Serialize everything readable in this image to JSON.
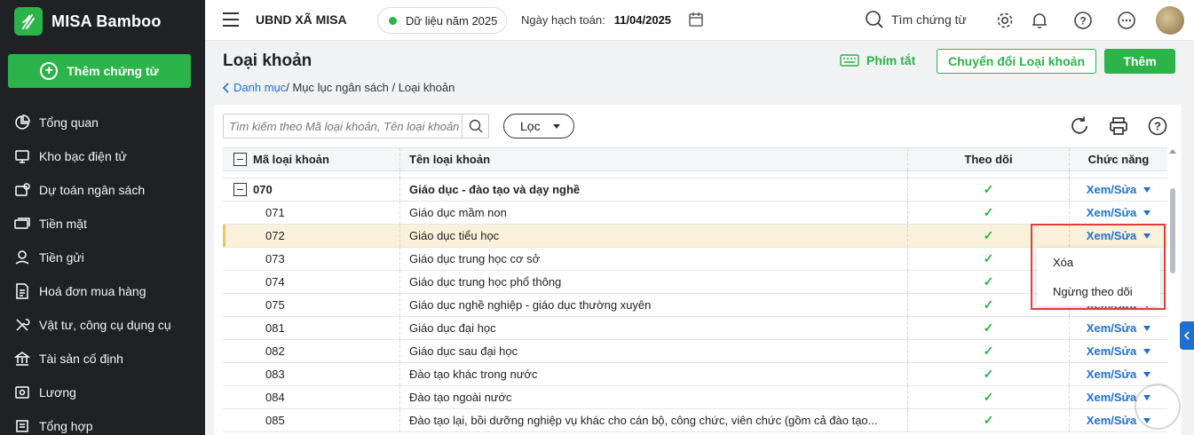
{
  "brand": {
    "name": "MISA Bamboo",
    "add_voucher": "Thêm chứng từ"
  },
  "sidebar": {
    "items": [
      {
        "label": "Tổng quan",
        "icon": "pie-chart-icon"
      },
      {
        "label": "Kho bạc điện tử",
        "icon": "monitor-icon"
      },
      {
        "label": "Dự toán ngân sách",
        "icon": "budget-icon"
      },
      {
        "label": "Tiền mặt",
        "icon": "cash-icon"
      },
      {
        "label": "Tiền gửi",
        "icon": "deposit-icon"
      },
      {
        "label": "Hoá đơn mua hàng",
        "icon": "invoice-icon"
      },
      {
        "label": "Vật tư, công cụ dụng cụ",
        "icon": "tools-icon"
      },
      {
        "label": "Tài sản cố định",
        "icon": "bank-icon"
      },
      {
        "label": "Lương",
        "icon": "salary-icon"
      },
      {
        "label": "Tổng hợp",
        "icon": "summary-icon"
      }
    ]
  },
  "topbar": {
    "org_name": "UBND XÃ MISA",
    "data_year": "Dữ liệu năm 2025",
    "posting_date_label": "Ngày hạch toán:",
    "posting_date": "11/04/2025",
    "search_label": "Tìm chứng từ"
  },
  "page": {
    "title": "Loại khoản",
    "breadcrumb_link": "Danh mục",
    "breadcrumb_rest": " / Mục lục ngân sách / Loại khoản",
    "shortcut_label": "Phím tắt",
    "convert_label": "Chuyển đổi Loại khoản",
    "add_label": "Thêm"
  },
  "toolbar": {
    "search_placeholder": "Tìm kiếm theo Mã loại khoản, Tên loại khoản",
    "filter_label": "Lọc"
  },
  "table": {
    "headers": {
      "code": "Mã loại khoản",
      "name": "Tên loại khoản",
      "follow": "Theo dõi",
      "action": "Chức năng"
    },
    "action_label": "Xem/Sửa",
    "check_mark": "✓",
    "rows": [
      {
        "code": "070",
        "name": "Giáo dục - đào tạo và dạy nghề",
        "bold": true
      },
      {
        "code": "071",
        "name": "Giáo dục mầm non"
      },
      {
        "code": "072",
        "name": "Giáo dục tiểu học",
        "selected": true
      },
      {
        "code": "073",
        "name": "Giáo dục trung học cơ sở"
      },
      {
        "code": "074",
        "name": "Giáo dục trung học phổ thông"
      },
      {
        "code": "075",
        "name": "Giáo dục nghề nghiệp - giáo dục thường xuyên"
      },
      {
        "code": "081",
        "name": "Giáo dục đại học"
      },
      {
        "code": "082",
        "name": "Giáo dục sau đại học"
      },
      {
        "code": "083",
        "name": "Đào tạo khác trong nước"
      },
      {
        "code": "084",
        "name": "Đào tạo ngoài nước"
      },
      {
        "code": "085",
        "name": "Đào tạo lại, bồi dưỡng nghiệp vụ khác cho cán bộ, công chức, viên chức (gồm cả đào tạo..."
      }
    ]
  },
  "dropdown": {
    "delete": "Xóa",
    "stop_follow": "Ngừng theo dõi"
  },
  "colors": {
    "accent": "#2cb34a",
    "link": "#1f6fcf",
    "sidebar": "#1f2225",
    "highlight": "#e23b3b"
  }
}
